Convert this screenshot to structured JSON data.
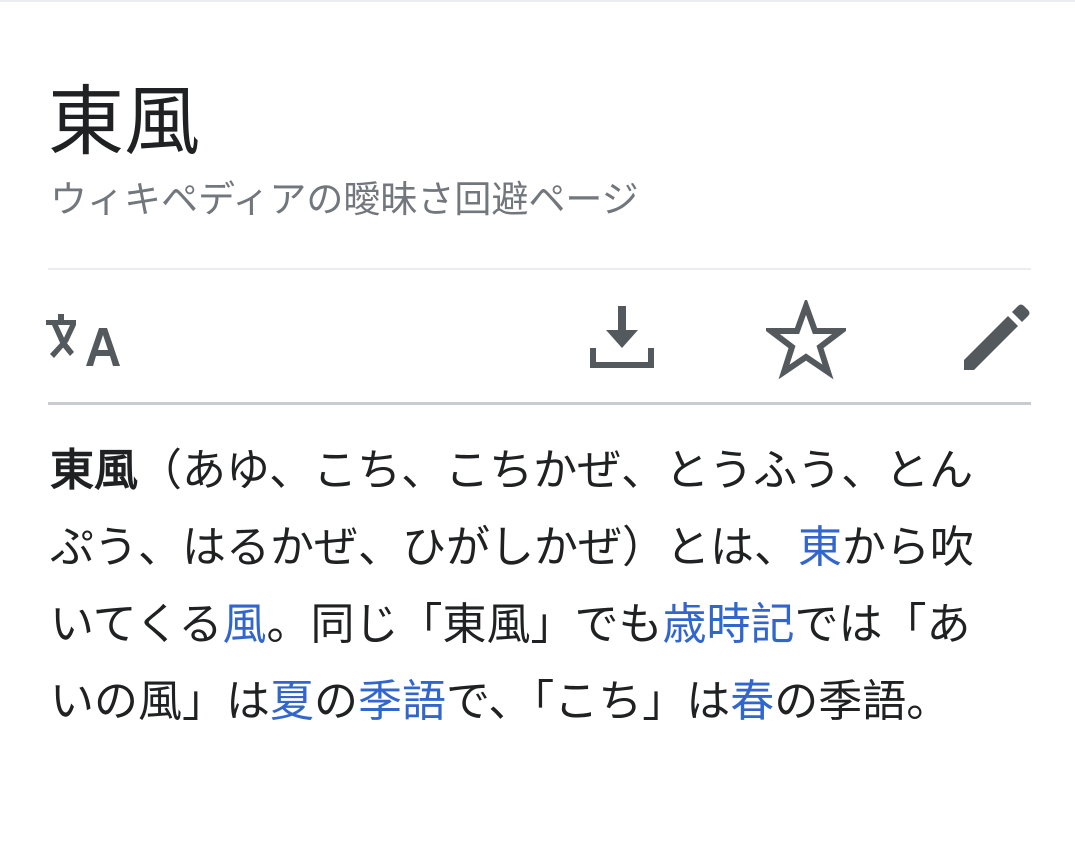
{
  "page": {
    "title": "東風",
    "tagline": "ウィキペディアの曖昧さ回避ページ"
  },
  "toolbar": {
    "language_icon": "language-icon",
    "download_icon": "download-icon",
    "watch_icon": "star-icon",
    "edit_icon": "pencil-icon"
  },
  "content": {
    "bold_term": "東風",
    "segments": [
      {
        "text": "（あゆ、こち、こちかぜ、とうふう、とんぷう、はるかぜ、ひがしかぜ）とは、",
        "link": false
      },
      {
        "text": "東",
        "link": true
      },
      {
        "text": "から吹いてくる",
        "link": false
      },
      {
        "text": "風",
        "link": true
      },
      {
        "text": "。同じ「東風」でも",
        "link": false
      },
      {
        "text": "歳時記",
        "link": true
      },
      {
        "text": "では「あいの風」は",
        "link": false
      },
      {
        "text": "夏",
        "link": true
      },
      {
        "text": "の",
        "link": false
      },
      {
        "text": "季語",
        "link": true
      },
      {
        "text": "で、「こち」は",
        "link": false
      },
      {
        "text": "春",
        "link": true
      },
      {
        "text": "の季語。",
        "link": false
      }
    ]
  },
  "colors": {
    "link": "#3366cc",
    "icon": "#54595d",
    "tagline": "#72777d",
    "divider": "#c8ccd1"
  }
}
